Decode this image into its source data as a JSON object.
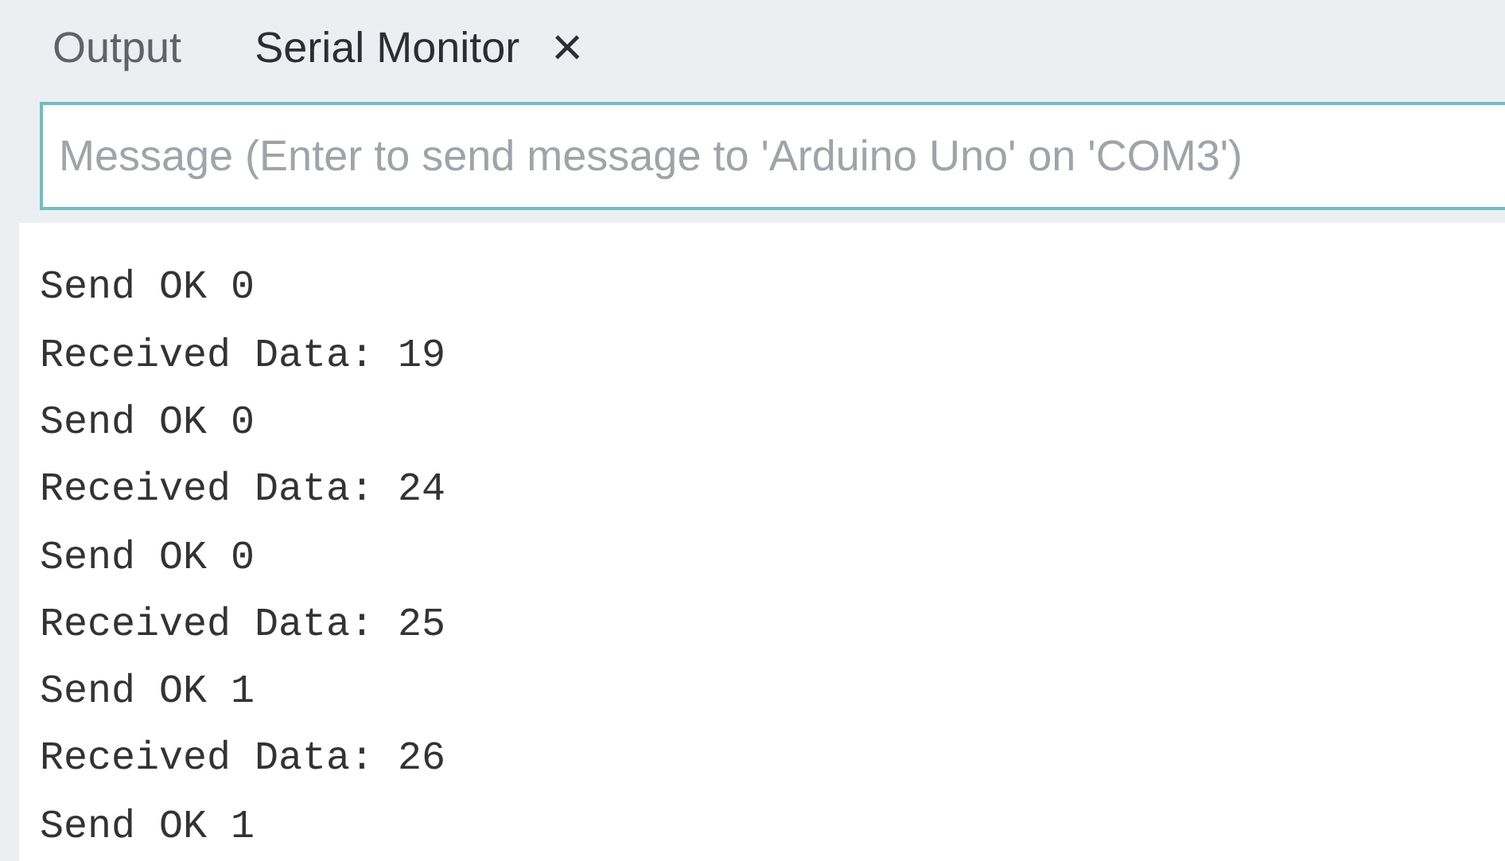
{
  "tabs": [
    {
      "label": "Output",
      "selected": false
    },
    {
      "label": "Serial Monitor",
      "selected": true,
      "close_icon": "×"
    }
  ],
  "message_field": {
    "placeholder": "Message (Enter to send message to 'Arduino Uno' on 'COM3')"
  },
  "output_lines": [
    "Send OK 0",
    "Received Data: 19",
    "Send OK 0",
    "Received Data: 24",
    "Send OK 0",
    "Received Data: 25",
    "Send OK 1",
    "Received Data: 26",
    "Send OK 1"
  ]
}
